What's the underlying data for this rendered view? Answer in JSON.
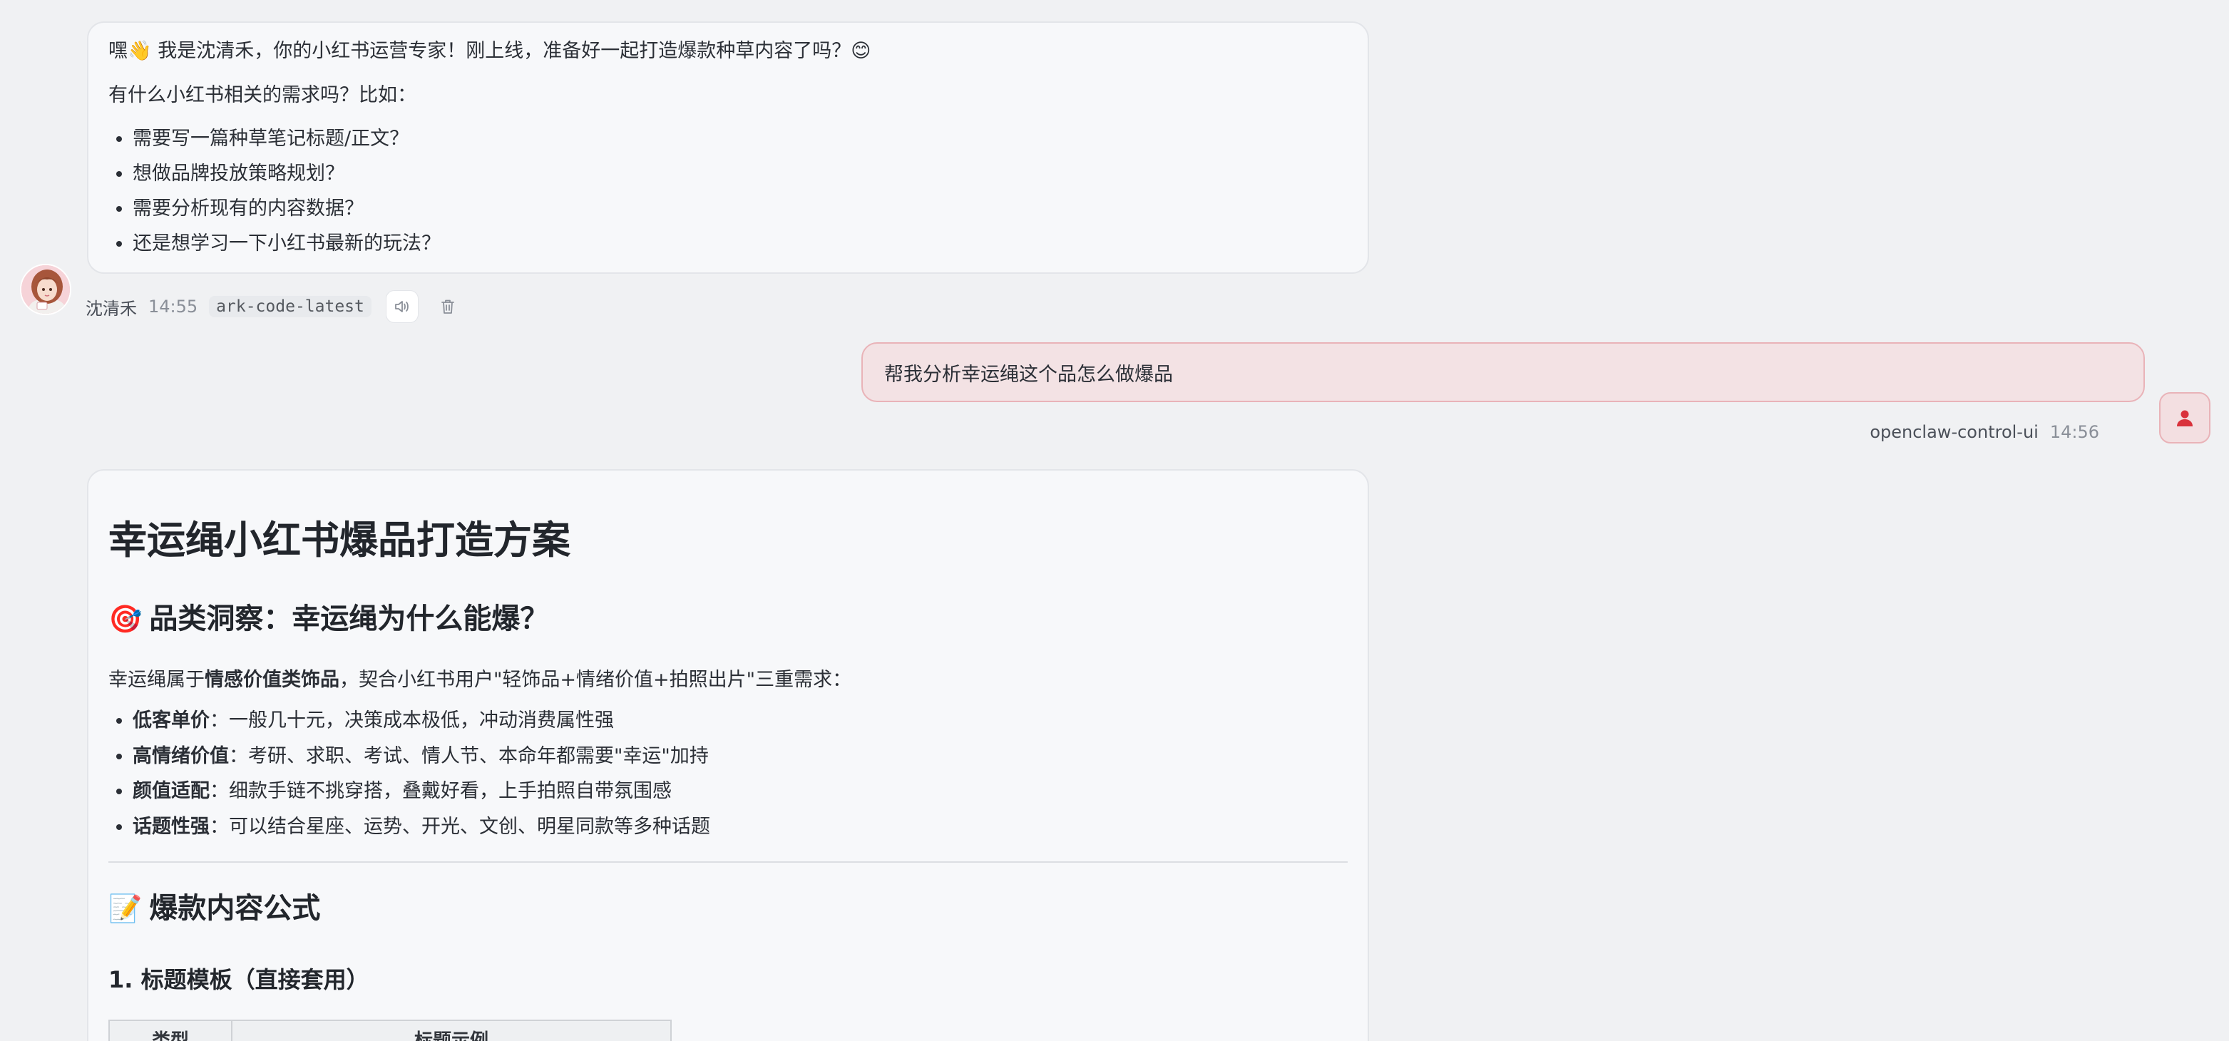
{
  "messages": {
    "assistant_1": {
      "greeting": "嘿👋 我是沈清禾，你的小红书运营专家！刚上线，准备好一起打造爆款种草内容了吗？😊",
      "prompt": "有什么小红书相关的需求吗？比如：",
      "items": [
        "需要写一篇种草笔记标题/正文？",
        "想做品牌投放策略规划？",
        "需要分析现有的内容数据？",
        "还是想学习一下小红书最新的玩法？"
      ],
      "meta": {
        "name": "沈清禾",
        "time": "14:55",
        "model": "ark-code-latest"
      }
    },
    "user_1": {
      "text": "帮我分析幸运绳这个品怎么做爆品",
      "meta": {
        "name": "openclaw-control-ui",
        "time": "14:56"
      }
    },
    "assistant_2": {
      "title": "幸运绳小红书爆品打造方案",
      "section1": {
        "emoji": "🎯",
        "heading": "品类洞察：幸运绳为什么能爆？",
        "intro_pre": "幸运绳属于",
        "intro_bold": "情感价值类饰品",
        "intro_post": "，契合小红书用户\"轻饰品+情绪价值+拍照出片\"三重需求：",
        "points": [
          {
            "label": "低客单价",
            "text": "：一般几十元，决策成本极低，冲动消费属性强"
          },
          {
            "label": "高情绪价值",
            "text": "：考研、求职、考试、情人节、本命年都需要\"幸运\"加持"
          },
          {
            "label": "颜值适配",
            "text": "：细款手链不挑穿搭，叠戴好看，上手拍照自带氛围感"
          },
          {
            "label": "话题性强",
            "text": "：可以结合星座、运势、开光、文创、明星同款等多种话题"
          }
        ]
      },
      "section2": {
        "emoji": "📝",
        "heading": "爆款内容公式",
        "sub1": "1. 标题模板（直接套用）",
        "table_headers": [
          "类型",
          "标题示例"
        ]
      }
    }
  },
  "colors": {
    "background": "#f0f1f3",
    "assistant_bubble": "#f7f8fa",
    "user_bubble": "#f3e2e4",
    "user_border": "#e9b3b8",
    "user_icon": "#d9323c"
  },
  "icons": [
    "assistant-avatar",
    "speaker-icon",
    "trash-icon",
    "user-avatar-icon"
  ]
}
